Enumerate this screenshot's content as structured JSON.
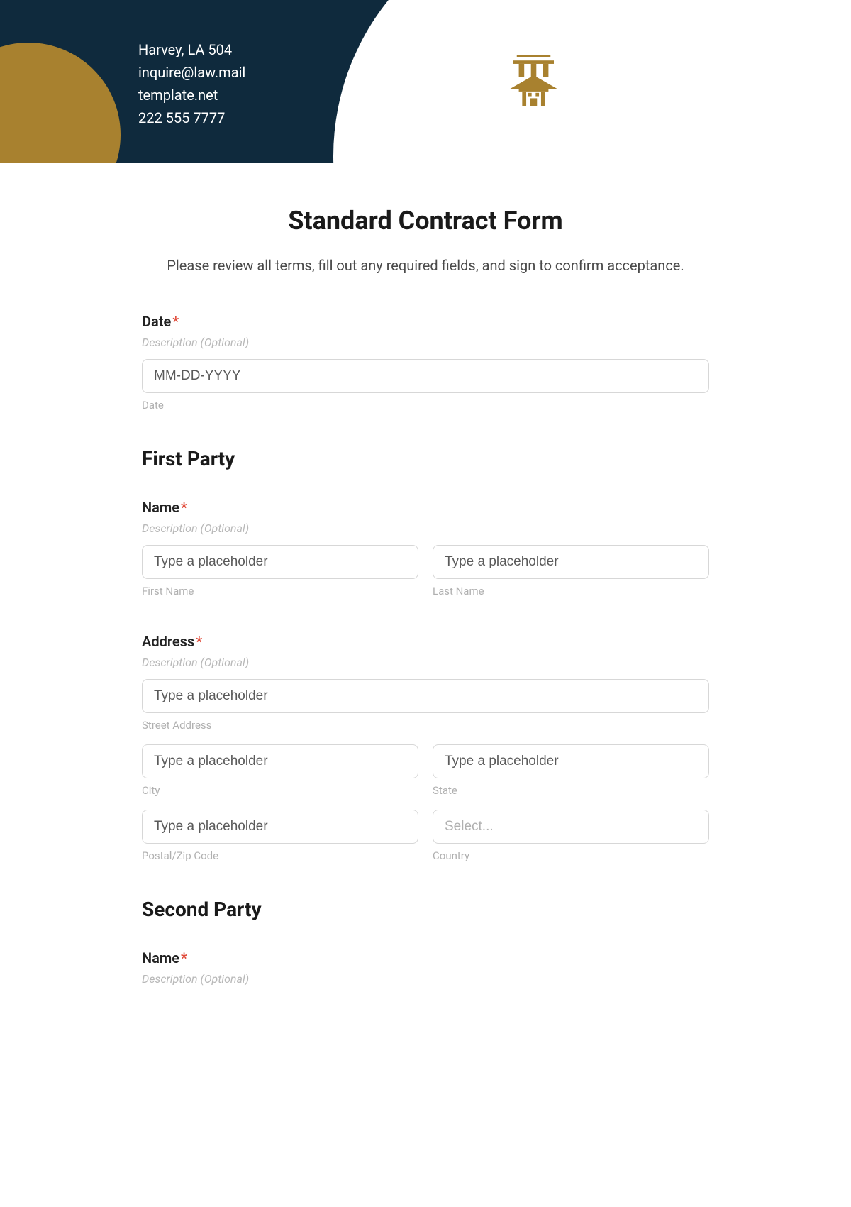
{
  "header": {
    "line1": "Harvey, LA 504",
    "line2": "inquire@law.mail",
    "line3": "template.net",
    "line4": "222 555 7777"
  },
  "title": "Standard Contract Form",
  "intro": "Please review all terms, fill out any required fields, and sign to confirm acceptance.",
  "date": {
    "label": "Date",
    "desc": "Description (Optional)",
    "placeholder": "MM-DD-YYYY",
    "sublabel": "Date"
  },
  "first_party": {
    "heading": "First Party",
    "name": {
      "label": "Name",
      "desc": "Description (Optional)",
      "first_placeholder": "Type a placeholder",
      "first_sublabel": "First Name",
      "last_placeholder": "Type a placeholder",
      "last_sublabel": "Last Name"
    },
    "address": {
      "label": "Address",
      "desc": "Description (Optional)",
      "street_placeholder": "Type a placeholder",
      "street_sublabel": "Street Address",
      "city_placeholder": "Type a placeholder",
      "city_sublabel": "City",
      "state_placeholder": "Type a placeholder",
      "state_sublabel": "State",
      "postal_placeholder": "Type a placeholder",
      "postal_sublabel": "Postal/Zip Code",
      "country_placeholder": "Select...",
      "country_sublabel": "Country"
    }
  },
  "second_party": {
    "heading": "Second Party",
    "name": {
      "label": "Name",
      "desc": "Description (Optional)"
    }
  },
  "required_marker": "*"
}
